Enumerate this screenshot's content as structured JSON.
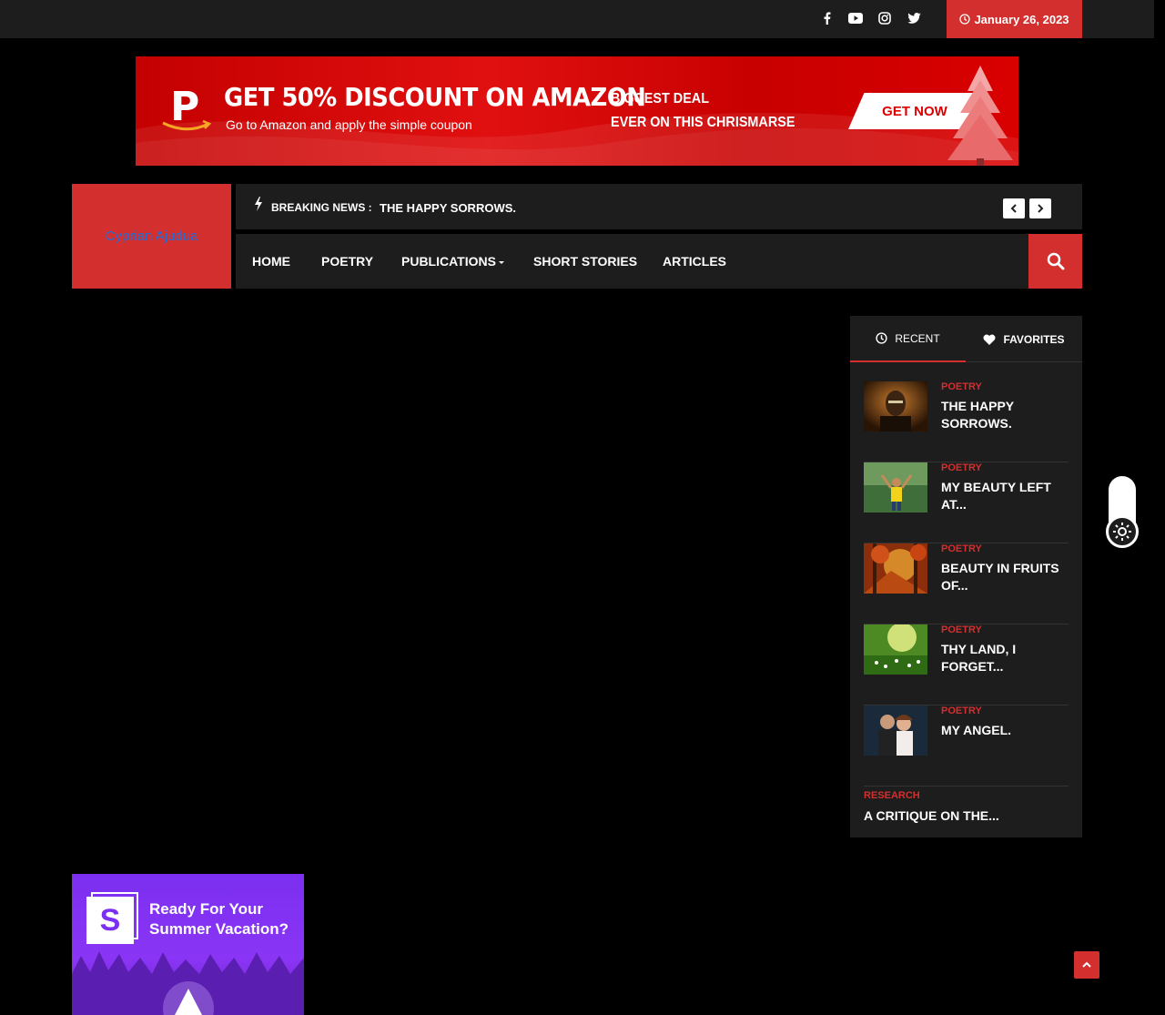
{
  "topbar": {
    "social_icons": [
      "facebook-icon",
      "youtube-icon",
      "instagram-icon",
      "twitter-icon"
    ],
    "date": "January 26, 2023"
  },
  "banner": {
    "logo_letter": "P",
    "headline": "GET 50% DISCOUNT ON AMAZON",
    "subline": "Go to Amazon and apply the simple coupon",
    "deal_line1": "BIGGEST DEAL",
    "deal_line2": "EVER ON THIS CHRISMARSE",
    "cta": "GET NOW"
  },
  "header": {
    "site_title": "Cyprian Ajudua",
    "breaking_label": "BREAKING NEWS :",
    "breaking_headline": "THE HAPPY SORROWS."
  },
  "nav": {
    "items": [
      "HOME",
      "POETRY",
      "PUBLICATIONS",
      "SHORT STORIES",
      "ARTICLES"
    ]
  },
  "sidebar": {
    "tabs": [
      "RECENT",
      "FAVORITES"
    ],
    "posts": [
      {
        "category": "POETRY",
        "title": "THE HAPPY SORROWS."
      },
      {
        "category": "POETRY",
        "title": "MY BEAUTY LEFT AT..."
      },
      {
        "category": "POETRY",
        "title": "BEAUTY IN FRUITS OF..."
      },
      {
        "category": "POETRY",
        "title": "THY LAND, I FORGET..."
      },
      {
        "category": "POETRY",
        "title": "MY ANGEL."
      },
      {
        "category": "RESEARCH",
        "title": "A CRITIQUE ON THE..."
      }
    ]
  },
  "ad2": {
    "logo_letter": "S",
    "line1": "Ready For Your",
    "line2": "Summer Vacation?"
  },
  "colors": {
    "accent": "#d32f2f",
    "panel": "#1d1d1d",
    "logo_text": "#1e6fd9"
  }
}
